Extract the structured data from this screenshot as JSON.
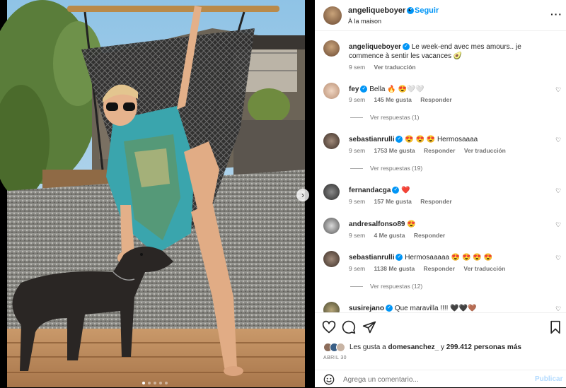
{
  "header": {
    "username": "angeliqueboyer",
    "separator": "•",
    "follow_label": "Seguir",
    "location": "À la maison",
    "more_label": "···"
  },
  "caption": {
    "username": "angeliqueboyer",
    "text": "Le week-end avec mes amours.. je commence à sentir les vacances 🥑",
    "age": "9 sem",
    "translate": "Ver traducción"
  },
  "comments": [
    {
      "username": "fey",
      "verified": true,
      "text": "Bella 🔥 😍🤍🤍",
      "age": "9 sem",
      "likes": "145 Me gusta",
      "reply": "Responder",
      "translate": "",
      "view_replies": "Ver respuestas (1)"
    },
    {
      "username": "sebastianrulli",
      "verified": true,
      "text": "😍 😍 😍 Hermosaaaa",
      "age": "9 sem",
      "likes": "1753 Me gusta",
      "reply": "Responder",
      "translate": "Ver traducción",
      "view_replies": "Ver respuestas (19)"
    },
    {
      "username": "fernandacga",
      "verified": true,
      "text": "❤️",
      "age": "9 sem",
      "likes": "157 Me gusta",
      "reply": "Responder",
      "translate": "",
      "view_replies": ""
    },
    {
      "username": "andresalfonso89",
      "verified": false,
      "text": "😍",
      "age": "9 sem",
      "likes": "4 Me gusta",
      "reply": "Responder",
      "translate": "",
      "view_replies": ""
    },
    {
      "username": "sebastianrulli",
      "verified": true,
      "text": "Hermosaaaaa 😍 😍 😍 😍",
      "age": "9 sem",
      "likes": "1138 Me gusta",
      "reply": "Responder",
      "translate": "Ver traducción",
      "view_replies": "Ver respuestas (12)"
    },
    {
      "username": "susirejano",
      "verified": true,
      "text": "Que maravilla !!!! 🖤🖤🤎",
      "age": "",
      "likes": "",
      "reply": "",
      "translate": "",
      "view_replies": ""
    }
  ],
  "likes": {
    "prefix": "Les gusta a",
    "user": "domesanchez_",
    "middle": "y",
    "count": "299.412 personas más"
  },
  "date": "ABRIL 30",
  "comment_box": {
    "placeholder": "Agrega un comentario...",
    "publish_label": "Publicar"
  },
  "icons": {
    "verified": "✓",
    "heart_small": "♡",
    "next": "›"
  },
  "colors": {
    "accent": "#0095f6",
    "verified": "#0095f6",
    "publish_disabled": "#b3dbff",
    "secondary_text": "#737373"
  }
}
